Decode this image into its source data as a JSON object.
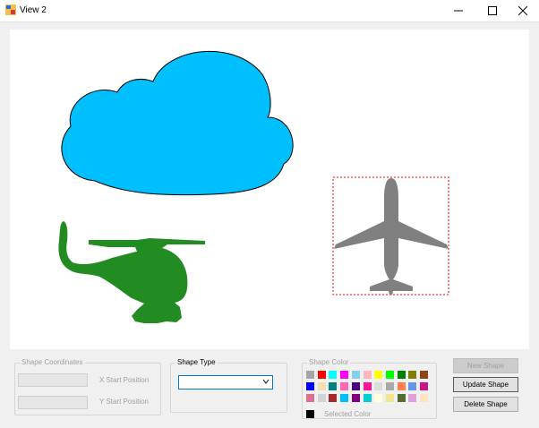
{
  "window": {
    "title": "View 2"
  },
  "shape_coordinates": {
    "legend": "Shape Coordinates",
    "x_label": "X Start Position",
    "y_label": "Y Start Position",
    "x_value": "",
    "y_value": ""
  },
  "shape_type": {
    "legend": "Shape Type",
    "selected": ""
  },
  "shape_color": {
    "legend": "Shape Color",
    "selected_label": "Selected Color",
    "selected_color": "#000000",
    "palette": [
      [
        "#a6a6a6",
        "#ff0000",
        "#00ffff",
        "#ff00ff",
        "#87ceeb",
        "#ffb6c1",
        "#ffff00",
        "#00ff00",
        "#008000",
        "#808000",
        "#8b4513"
      ],
      [
        "#0000ff",
        "#f5deb3",
        "#008080",
        "#ff69b4",
        "#4b0082",
        "#ff1493",
        "#dcdcdc",
        "#a9a9a9",
        "#ff7f50",
        "#6495ed",
        "#c71585"
      ],
      [
        "#db7093",
        "#d3d3d3",
        "#a52a2a",
        "#00bfff",
        "#800080",
        "#00ced1",
        "#ffffe0",
        "#f0e68c",
        "#556b2f",
        "#dda0dd",
        "#ffe4c4"
      ]
    ]
  },
  "buttons": {
    "new_shape": "New Shape",
    "update_shape": "Update Shape",
    "delete_shape": "Delete Shape"
  },
  "colors": {
    "cloud": "#00bfff",
    "helicopter": "#228b22",
    "airplane": "#808080",
    "selection": "#ff0000"
  }
}
